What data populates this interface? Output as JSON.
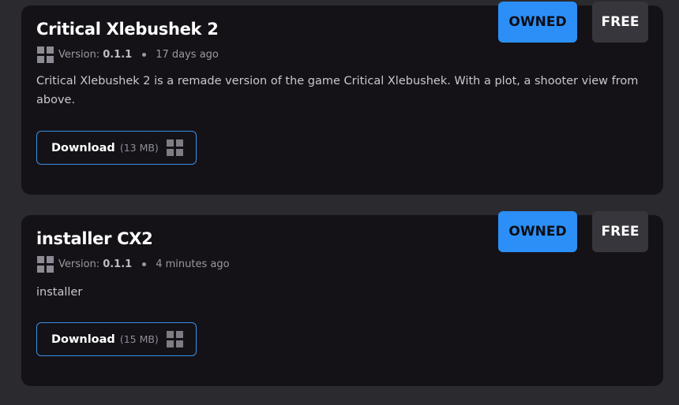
{
  "builds": [
    {
      "title": "Critical Xlebushek 2",
      "platform_icon": "windows-icon",
      "version_label": "Version:",
      "version_value": "0.1.1",
      "updated": "17 days ago",
      "description": "Critical Xlebushek 2 is a remade version of the game Critical Xlebushek. With a plot, a shooter view from above.",
      "download_label": "Download",
      "download_size": "(13 MB)",
      "owned_label": "OWNED",
      "price_label": "FREE"
    },
    {
      "title": "installer CX2",
      "platform_icon": "windows-icon",
      "version_label": "Version:",
      "version_value": "0.1.1",
      "updated": "4 minutes ago",
      "description": "installer",
      "download_label": "Download",
      "download_size": "(15 MB)",
      "owned_label": "OWNED",
      "price_label": "FREE"
    }
  ],
  "colors": {
    "page_bg": "#2b2a2e",
    "card_bg": "#141217",
    "accent": "#2c8ff8",
    "owned_badge": "#2c8ff8",
    "free_badge": "#38363d",
    "download_border": "#3b8ee6"
  }
}
